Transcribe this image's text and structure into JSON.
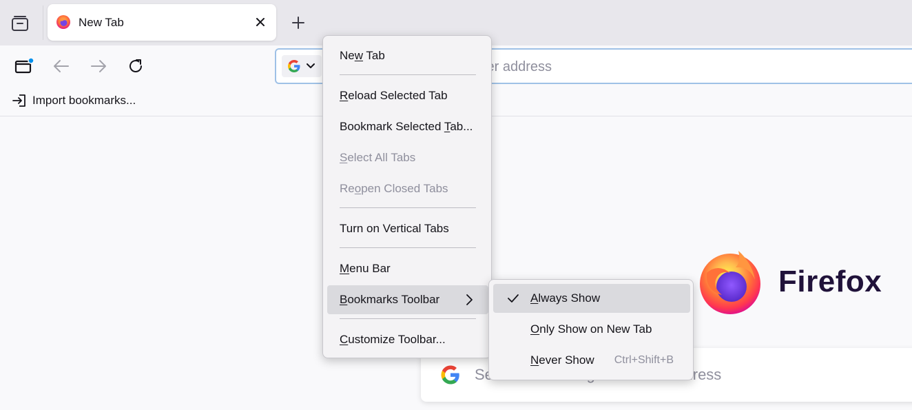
{
  "tab": {
    "title": "New Tab"
  },
  "urlbar": {
    "placeholder": "Search with Google or enter address",
    "visible_fragment": "ter address"
  },
  "bookmarks_toolbar": {
    "import_label": "Import bookmarks..."
  },
  "newtab_page": {
    "brand": "Firefox",
    "search_placeholder": "Search with Google or enter address"
  },
  "context_menu": {
    "items": [
      {
        "label": "New Tab",
        "access": "w",
        "state": "normal"
      },
      {
        "label": "Reload Selected Tab",
        "access": "R",
        "state": "normal"
      },
      {
        "label": "Bookmark Selected Tab...",
        "access": "T",
        "state": "normal"
      },
      {
        "label": "Select All Tabs",
        "access": "S",
        "state": "disabled"
      },
      {
        "label": "Reopen Closed Tabs",
        "access": "o",
        "state": "disabled"
      },
      {
        "label": "Turn on Vertical Tabs",
        "access": "",
        "state": "normal"
      },
      {
        "label": "Menu Bar",
        "access": "M",
        "state": "normal"
      },
      {
        "label": "Bookmarks Toolbar",
        "access": "B",
        "state": "hover",
        "submenu": true
      },
      {
        "label": "Customize Toolbar...",
        "access": "C",
        "state": "normal"
      }
    ]
  },
  "submenu": {
    "items": [
      {
        "label": "Always Show",
        "access": "A",
        "checked": true,
        "shortcut": ""
      },
      {
        "label": "Only Show on New Tab",
        "access": "O",
        "checked": false,
        "shortcut": ""
      },
      {
        "label": "Never Show",
        "access": "N",
        "checked": false,
        "shortcut": "Ctrl+Shift+B"
      }
    ]
  },
  "colors": {
    "accent": "#0090ed",
    "focus_ring": "#9fc1e6",
    "brand_text": "#20123a"
  }
}
